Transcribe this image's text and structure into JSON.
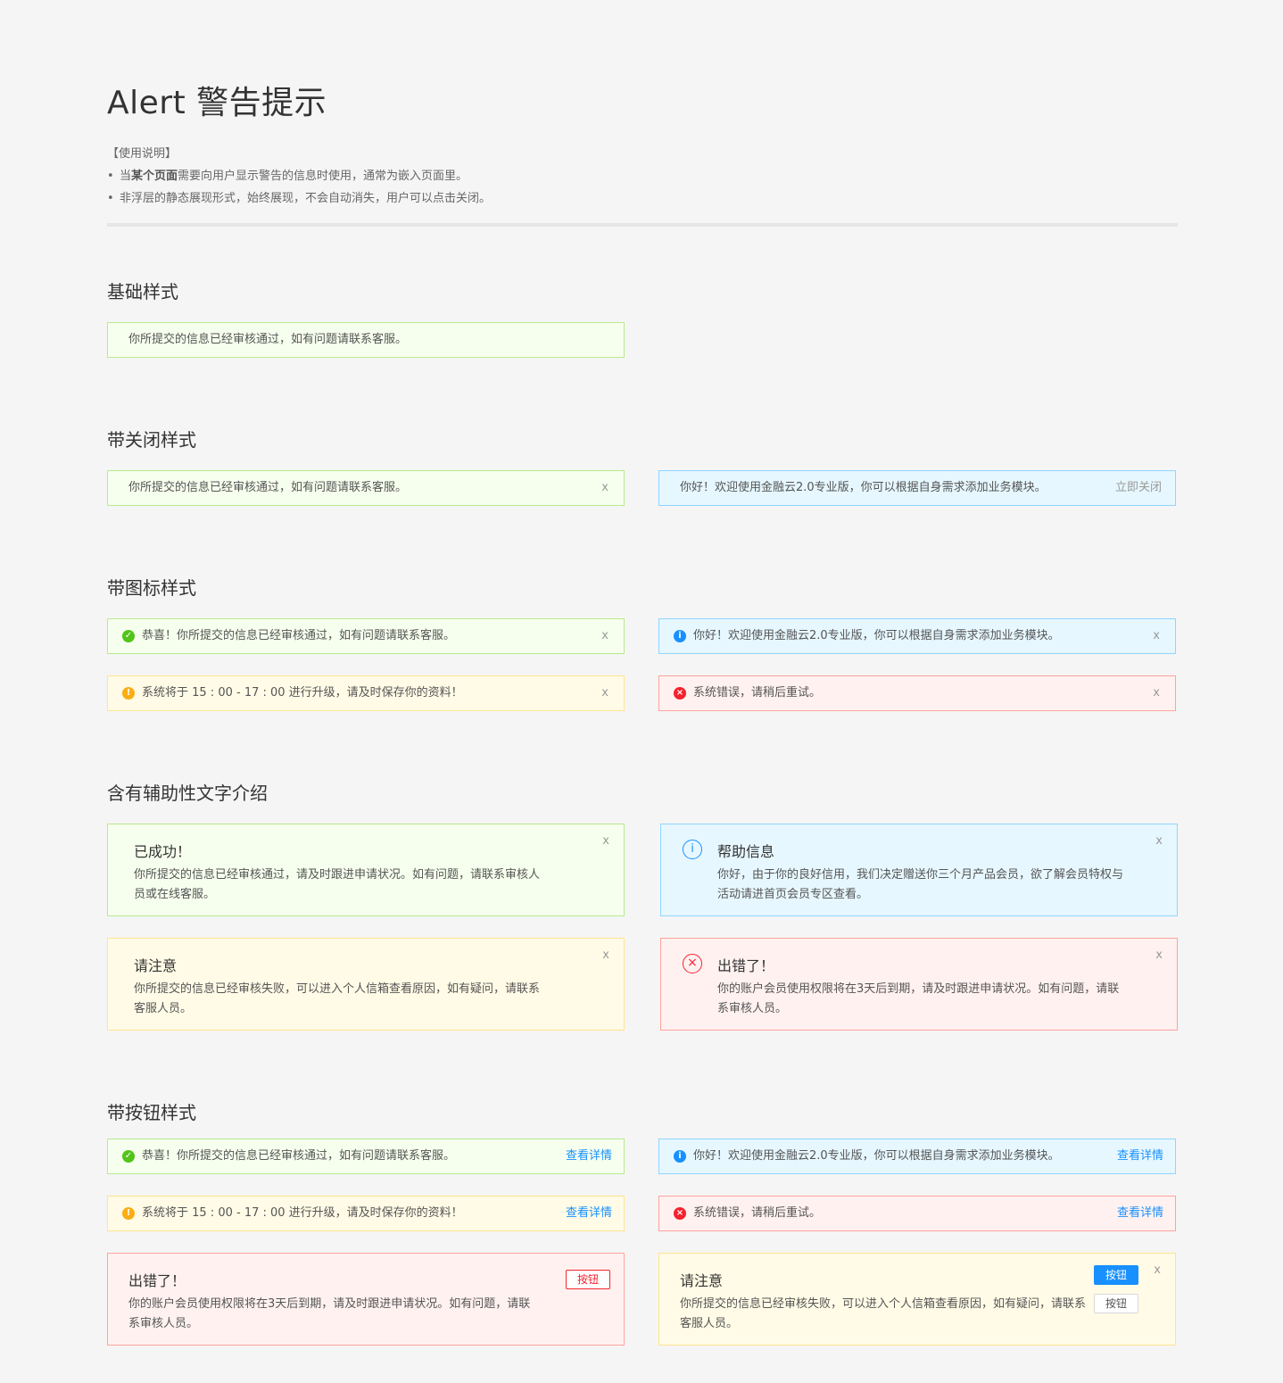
{
  "page": {
    "title": "Alert 警告提示",
    "usage_heading": "【使用说明】",
    "usage_lines": [
      {
        "prefix": "当",
        "bold": "某个页面",
        "suffix": "需要向用户显示警告的信息时使用，通常为嵌入页面里。"
      },
      {
        "prefix": "非浮层的静态展现形式，始终展现，不会自动消失，用户可以点击关闭。",
        "bold": "",
        "suffix": ""
      }
    ]
  },
  "sections": {
    "basic": "基础样式",
    "closable": "带关闭样式",
    "icon": "带图标样式",
    "description": "含有辅助性文字介绍",
    "button": "带按钮样式"
  },
  "basic": {
    "success_msg": "你所提交的信息已经审核通过，如有问题请联系客服。"
  },
  "closable": {
    "success_msg": "你所提交的信息已经审核通过，如有问题请联系客服。",
    "close_x": "x",
    "info_msg": "你好！欢迎使用金融云2.0专业版，你可以根据自身需求添加业务模块。",
    "close_text": "立即关闭"
  },
  "icon_alerts": {
    "success_msg": "恭喜！你所提交的信息已经审核通过，如有问题请联系客服。",
    "info_msg": "你好！欢迎使用金融云2.0专业版，你可以根据自身需求添加业务模块。",
    "warning_msg": "系统将于 15 : 00 - 17 : 00 进行升级，请及时保存你的资料！",
    "error_msg": "系统错误，请稍后重试。",
    "close_x": "x"
  },
  "desc_alerts": {
    "success": {
      "title": "已成功！",
      "desc": "你所提交的信息已经审核通过，请及时跟进申请状况。如有问题，请联系审核人员或在线客服。"
    },
    "info": {
      "title": "帮助信息",
      "desc": "你好，由于你的良好信用，我们决定赠送你三个月产品会员，欲了解会员特权与活动请进首页会员专区查看。"
    },
    "warning": {
      "title": "请注意",
      "desc": "你所提交的信息已经审核失败，可以进入个人信箱查看原因，如有疑问，请联系客服人员。"
    },
    "error": {
      "title": "出错了！",
      "desc": "你的账户会员使用权限将在3天后到期，请及时跟进申请状况。如有问题，请联系审核人员。"
    },
    "close_x": "x"
  },
  "button_alerts": {
    "success_msg": "恭喜！你所提交的信息已经审核通过，如有问题请联系客服。",
    "info_msg": "你好！欢迎使用金融云2.0专业版，你可以根据自身需求添加业务模块。",
    "warning_msg": "系统将于 15 : 00 - 17 : 00 进行升级，请及时保存你的资料！",
    "error_msg": "系统错误，请稍后重试。",
    "link_label": "查看详情",
    "error_big": {
      "title": "出错了！",
      "desc": "你的账户会员使用权限将在3天后到期，请及时跟进申请状况。如有问题，请联系审核人员。",
      "button": "按钮"
    },
    "warning_big": {
      "title": "请注意",
      "desc": "你所提交的信息已经审核失败，可以进入个人信箱查看原因，如有疑问，请联系客服人员。",
      "button_primary": "按钮",
      "button_secondary": "按钮"
    },
    "close_x": "x"
  },
  "icons": {
    "success": "✓",
    "info": "i",
    "warning": "!",
    "error": "×"
  },
  "colors": {
    "success": "#52c41a",
    "info": "#1890ff",
    "warning": "#faad14",
    "error": "#f5222d"
  }
}
